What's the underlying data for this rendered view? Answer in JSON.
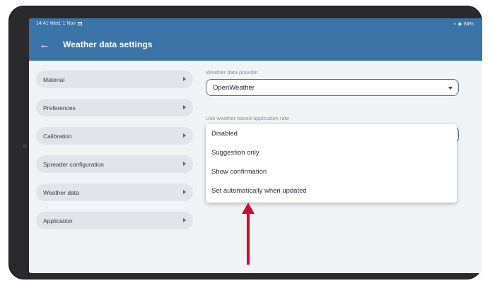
{
  "status_bar": {
    "time_date": "14:41 Wed, 1 Nov",
    "indicators": "84%"
  },
  "app_bar": {
    "title": "Weather data settings",
    "back_icon": "arrow-left-icon"
  },
  "menu": {
    "items": [
      {
        "label": "Material"
      },
      {
        "label": "Preferences"
      },
      {
        "label": "Calibration"
      },
      {
        "label": "Spreader configuration"
      },
      {
        "label": "Weather data"
      },
      {
        "label": "Application"
      }
    ]
  },
  "weather_provider": {
    "label": "Weather data provider",
    "value": "OpenWeather"
  },
  "application_rate": {
    "label": "Use weather-based application rate",
    "options": [
      "Disabled",
      "Suggestion only",
      "Show confirmation",
      "Set automatically when updated"
    ]
  },
  "colors": {
    "app_bar": "#3b75a8",
    "menu_item_bg": "#e1e4e8",
    "annotation_arrow": "#c8102e"
  }
}
